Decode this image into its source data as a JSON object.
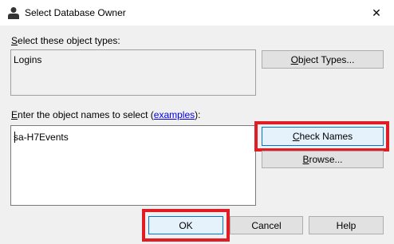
{
  "window": {
    "title": "Select Database Owner",
    "close_glyph": "✕"
  },
  "object_types": {
    "label_prefix": "",
    "label_underlined": "S",
    "label_rest": "elect these object types:",
    "value": "Logins",
    "button_underlined": "O",
    "button_rest": "bject Types..."
  },
  "object_names": {
    "label_underlined": "E",
    "label_rest": "nter the object names to select (",
    "link_text": "examples",
    "label_suffix": "):",
    "value": "sa-H7Events"
  },
  "buttons": {
    "check_names_underlined": "C",
    "check_names_rest": "heck Names",
    "browse_underlined": "B",
    "browse_rest": "rowse...",
    "ok": "OK",
    "cancel": "Cancel",
    "help": "Help"
  },
  "colors": {
    "highlight": "#e01c24",
    "focus": "#0078d7",
    "link": "#0000ee"
  },
  "icons": {
    "title": "user-icon",
    "close": "close-icon"
  }
}
